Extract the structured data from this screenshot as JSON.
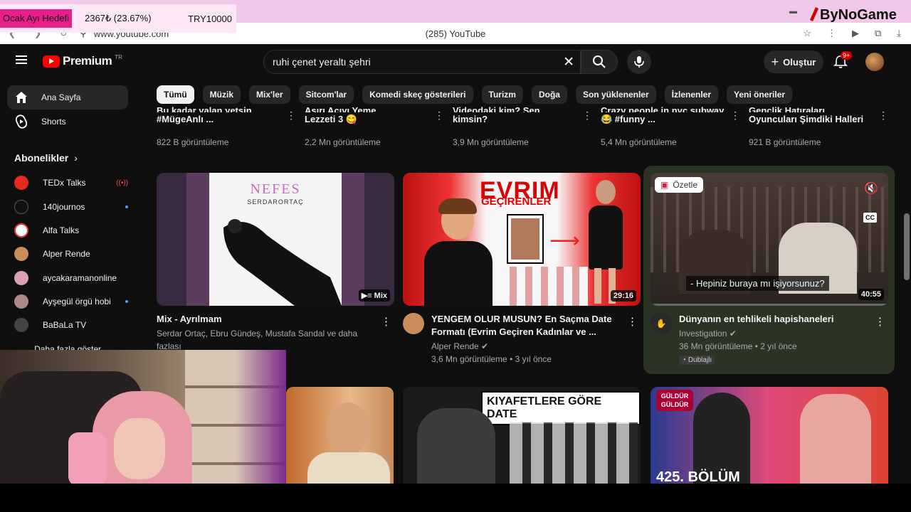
{
  "overlay": {
    "goal_label": "Ocak Ayı Hedefi",
    "goal_amount": "2367₺ (23.67%)",
    "goal_target": "TRY10000",
    "goal_progress": 0.2367,
    "brand": "ByNoGame"
  },
  "browser": {
    "url": "www.youtube.com",
    "tab_title": "(285) YouTube"
  },
  "header": {
    "logo_text": "Premium",
    "logo_country": "TR",
    "search_value": "ruhi çenet yeraltı şehri",
    "create_label": "Oluştur",
    "notification_count": "9+"
  },
  "sidebar": {
    "items": [
      {
        "label": "Ana Sayfa"
      },
      {
        "label": "Shorts"
      }
    ],
    "subs_heading": "Abonelikler",
    "subscriptions": [
      {
        "name": "TEDx Talks",
        "indicator": "live"
      },
      {
        "name": "140journos",
        "indicator": "dot"
      },
      {
        "name": "Alfa Talks",
        "indicator": ""
      },
      {
        "name": "Alper Rende",
        "indicator": ""
      },
      {
        "name": "aycakaramanonline",
        "indicator": ""
      },
      {
        "name": "Ayşegül örgü hobi",
        "indicator": "dot"
      },
      {
        "name": "BaBaLa TV",
        "indicator": ""
      }
    ],
    "show_more": "Daha fazla göster"
  },
  "chips": [
    "Tümü",
    "Müzik",
    "Mix'ler",
    "Sitcom'lar",
    "Komedi skeç gösterileri",
    "Turizm",
    "Doğa",
    "Son yüklenenler",
    "İzlenenler",
    "Yeni öneriler"
  ],
  "top_row": [
    {
      "title_clip": "Bu kadar yalan yetsin",
      "title": "#MügeAnlı ...",
      "meta": "822 B görüntüleme"
    },
    {
      "title_clip": "Aşırı Acıyı Yeme",
      "title": "Lezzeti 3 😋",
      "meta": "2,2 Mn görüntüleme"
    },
    {
      "title_clip": "Videodaki kim? Sen",
      "title": "kimsin?",
      "meta": "3,9 Mn görüntüleme"
    },
    {
      "title_clip": "Crazy people in nyc subway",
      "title": "😂 #funny ...",
      "meta": "5,4 Mn görüntüleme"
    },
    {
      "title_clip": "Gençlik Hatıraları",
      "title": "Oyuncuları Şimdiki Halleri",
      "meta": "921 B görüntüleme"
    }
  ],
  "cards": [
    {
      "title": "Mix - Ayrılmam",
      "meta1": "Serdar Ortaç, Ebru Gündeş, Mustafa Sandal ve daha fazlası",
      "badge": "Mix",
      "thumb_title": "NEFES",
      "thumb_artist": "SERDARORTAÇ"
    },
    {
      "title": "YENGEM OLUR MUSUN? En Saçma Date Formatı (Evrim Geçiren Kadınlar ve ...",
      "channel": "Alper Rende",
      "stats": "3,6 Mn görüntüleme • 3 yıl önce",
      "duration": "29:16",
      "thumb_text1": "EVRIM",
      "thumb_text2": "GEÇİRENLER"
    },
    {
      "title": "Dünyanın en tehlikeli hapishaneleri",
      "channel": "Investigation",
      "stats": "36 Mn görüntüleme • 2 yıl önce",
      "tag": "Dublajlı",
      "duration": "40:55",
      "summary_label": "Özetle",
      "subtitle": "- Hepiniz buraya mı işiyorsunuz?"
    }
  ],
  "bottom_row": [
    {
      "thumb_text": ""
    },
    {
      "thumb_text": "KIYAFETLERE GÖRE DATE"
    },
    {
      "thumb_text": "425. BÖLÜM",
      "logo": "GÜLDÜR GÜLDÜR"
    }
  ],
  "colors": {
    "background": "#0f0f0f",
    "chip": "#272727",
    "accent_red": "#ff0000",
    "overlay_pink": "#e91e8c",
    "highlight": "#2b3322"
  }
}
